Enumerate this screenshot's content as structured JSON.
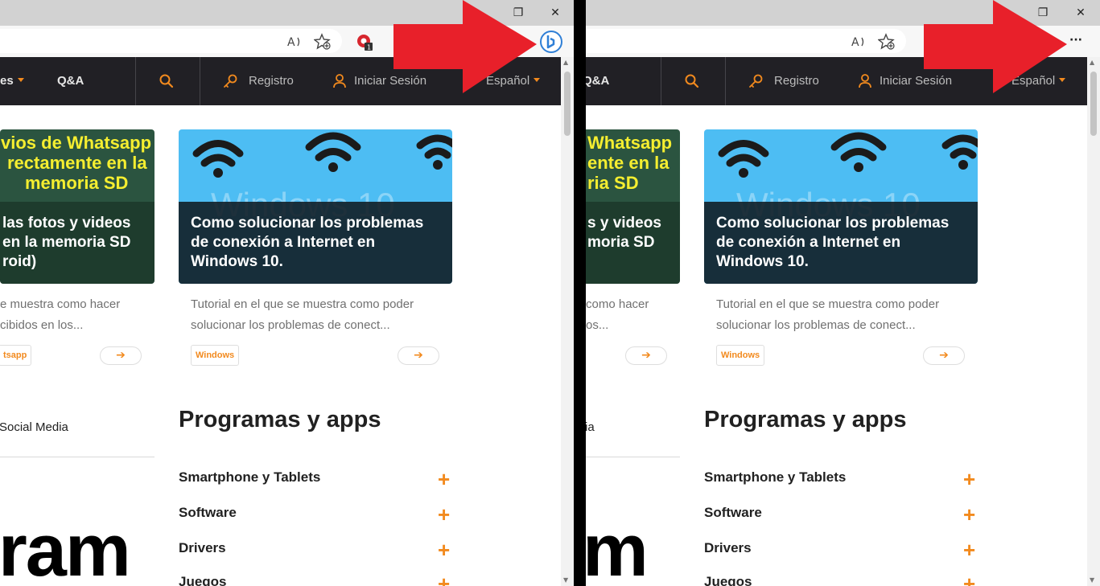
{
  "browser": {
    "restore_glyph": "❐",
    "close_glyph": "✕",
    "more_menu_glyph": "···",
    "toolbar_icons": [
      "read-aloud-icon",
      "favorites-add-icon",
      "extension-icon",
      "bing-copilot-icon",
      "more-menu-icon"
    ],
    "extension_badge": "1"
  },
  "nav": {
    "partial_item": "es",
    "qa": "Q&A",
    "search_icon": "search-icon",
    "register": "Registro",
    "login": "Iniciar Sesión",
    "language": "Español"
  },
  "cards": [
    {
      "image_text_top": [
        "vios de Whatsapp",
        "rectamente en la",
        "memoria SD"
      ],
      "title_partial": [
        "las fotos y videos",
        "en la memoria SD",
        "roid)"
      ],
      "excerpt": [
        "e muestra como hacer",
        "cibidos en los..."
      ],
      "tag": "tsapp",
      "more_icon": "arrow-right-icon"
    },
    {
      "image_watermark": "Windows 10",
      "title": [
        "Como solucionar los problemas",
        "de conexión a Internet en",
        "Windows 10."
      ],
      "excerpt": [
        "Tutorial en el que se muestra como poder",
        "solucionar los problemas de conect..."
      ],
      "tag": "Windows",
      "more_icon": "arrow-right-icon"
    }
  ],
  "right_partial": {
    "image_text_top": [
      "Whatsapp",
      "ente en la",
      "ria SD"
    ],
    "title_partial": [
      "s y videos",
      "moria SD"
    ],
    "excerpt": [
      "como hacer",
      "os..."
    ],
    "social": "ia",
    "big_word": "m",
    "nav_partial": "Q&A"
  },
  "sidebar": {
    "social_media": "Social Media",
    "big_word": "ram"
  },
  "programs": {
    "title": "Programas y apps",
    "categories": [
      "Smartphone y Tablets",
      "Software",
      "Drivers",
      "Juegos"
    ],
    "expand_glyph": "+"
  },
  "colors": {
    "accent": "#f28a1e",
    "navbar": "#212025",
    "annotation_arrow": "#e8202a"
  }
}
